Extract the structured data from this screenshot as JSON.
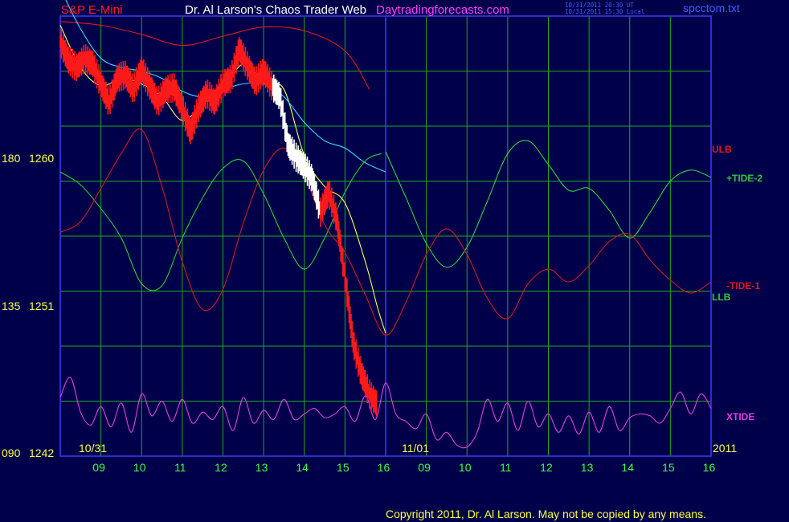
{
  "header": {
    "symbol": "S&P E-Mini",
    "title": "Dr. Al Larson's Chaos Trader Web",
    "site": "Daytradingforecasts.com",
    "timestamp_ut": "10/31/2011 20:30 UT",
    "timestamp_local": "10/31/2011 15:30 Local",
    "filename": "spcctom.txt"
  },
  "footer": {
    "copyright": "Copyright 2011, Dr. Al Larson. May not be copied by any means."
  },
  "colors": {
    "background": "#00004a",
    "grid": "#1fa81f",
    "frame": "#3a3aff",
    "price": "#ff1a1a",
    "price_recent": "#ffffff",
    "ulb": "#e01a1a",
    "llb": "#2ecc2e",
    "tide": "#3ad23a",
    "tide_neg": "#d21a1a",
    "xtide": "#e040e0",
    "ma_fast": "#ffff50",
    "ma_slow": "#40d8ff"
  },
  "chart_data": {
    "type": "line",
    "title": "S&P E-Mini",
    "y_axis": {
      "range": [
        1242,
        1266
      ],
      "ticks": [
        {
          "angle_label": "180",
          "price_label": "1260",
          "value": 1260
        },
        {
          "angle_label": "135",
          "price_label": "1251",
          "value": 1251
        },
        {
          "angle_label": "090",
          "price_label": "1242",
          "value": 1242
        }
      ]
    },
    "x_axis": {
      "hour_ticks": [
        "09",
        "10",
        "11",
        "12",
        "13",
        "14",
        "15",
        "16",
        "09",
        "10",
        "11",
        "12",
        "13",
        "14",
        "15",
        "16"
      ],
      "date_labels": [
        "10/31",
        "11/01"
      ],
      "year_label": "2011"
    },
    "series_labels": [
      "ULB",
      "+TIDE-2",
      "-TIDE-1",
      "LLB",
      "XTIDE"
    ],
    "series": [
      {
        "name": "ULB",
        "x": [
          0,
          1,
          2,
          3,
          4,
          5,
          6,
          7,
          7.6
        ],
        "y": [
          1265.7,
          1265.5,
          1265.0,
          1264.4,
          1264.9,
          1265.4,
          1265.2,
          1264.1,
          1262.0
        ]
      },
      {
        "name": "LLB",
        "x": [
          0,
          0.5,
          1,
          1.5,
          2,
          2.5,
          3,
          3.5,
          4,
          4.5,
          5,
          5.5,
          6,
          6.5,
          7,
          7.5,
          7.9
        ],
        "y": [
          1257.5,
          1256.8,
          1255.5,
          1253.9,
          1251.4,
          1251.3,
          1253.9,
          1256.1,
          1257.7,
          1258.1,
          1256.3,
          1253.9,
          1252.2,
          1253.9,
          1256.4,
          1258.1,
          1258.5
        ]
      },
      {
        "name": "+TIDE-2",
        "x": [
          8.0,
          8.5,
          9.0,
          9.5,
          10.0,
          10.5,
          11.0,
          11.5,
          12.0,
          12.5,
          13.0,
          13.5,
          14.0,
          14.5,
          15.0,
          15.5,
          16.0
        ],
        "y": [
          1258.6,
          1256.1,
          1253.6,
          1252.3,
          1253.4,
          1255.9,
          1258.5,
          1259.2,
          1257.9,
          1256.5,
          1256.6,
          1255.4,
          1253.9,
          1255.3,
          1257.0,
          1257.6,
          1257.2
        ]
      },
      {
        "name": "-TIDE-1",
        "x": [
          0,
          0.5,
          1,
          1.5,
          2,
          2.5,
          3,
          3.5,
          4,
          4.5,
          5,
          5.5,
          6,
          6.5,
          7,
          7.5,
          8,
          8.5,
          9,
          9.5,
          10,
          10.5,
          11,
          11.5,
          12,
          12.5,
          13,
          13.5,
          14,
          14.5,
          15,
          15.5,
          16
        ],
        "y": [
          1254.2,
          1254.8,
          1256.6,
          1258.5,
          1259.8,
          1256.7,
          1252.6,
          1250.0,
          1251.1,
          1254.7,
          1257.6,
          1258.8,
          1257.3,
          1254.6,
          1253.1,
          1250.8,
          1248.6,
          1250.4,
          1253.0,
          1254.4,
          1253.0,
          1250.6,
          1249.5,
          1251.4,
          1252.2,
          1251.5,
          1252.4,
          1253.7,
          1254.1,
          1252.7,
          1251.6,
          1250.9,
          1251.5
        ]
      },
      {
        "name": "XTIDE",
        "x": [
          0,
          0.25,
          0.5,
          0.75,
          1,
          1.25,
          1.5,
          1.75,
          2,
          2.25,
          2.5,
          2.75,
          3,
          3.25,
          3.5,
          3.75,
          4,
          4.25,
          4.5,
          4.75,
          5,
          5.25,
          5.5,
          5.75,
          6,
          6.25,
          6.5,
          6.75,
          7,
          7.25,
          7.5,
          7.75,
          8,
          8.25,
          8.5,
          8.75,
          9,
          9.25,
          9.5,
          9.75,
          10,
          10.25,
          10.5,
          10.75,
          11,
          11.25,
          11.5,
          11.75,
          12,
          12.25,
          12.5,
          12.75,
          13,
          13.25,
          13.5,
          13.75,
          14,
          14.25,
          14.5,
          14.75,
          15,
          15.25,
          15.5,
          15.75,
          16
        ],
        "y": [
          1245.2,
          1246.3,
          1244.4,
          1243.7,
          1244.7,
          1243.6,
          1244.9,
          1243.3,
          1245.4,
          1244.2,
          1245.0,
          1243.9,
          1245.1,
          1243.8,
          1244.4,
          1244.0,
          1244.7,
          1243.4,
          1245.2,
          1243.8,
          1244.5,
          1244.0,
          1245.1,
          1244.0,
          1244.3,
          1244.6,
          1244.1,
          1244.3,
          1244.7,
          1243.9,
          1245.3,
          1244.0,
          1246.0,
          1244.3,
          1243.9,
          1243.5,
          1244.3,
          1242.9,
          1243.3,
          1242.6,
          1242.5,
          1243.3,
          1245.1,
          1243.9,
          1244.9,
          1243.4,
          1245.0,
          1243.6,
          1244.3,
          1243.3,
          1244.2,
          1243.2,
          1244.4,
          1243.3,
          1244.7,
          1243.4,
          1244.1,
          1244.3,
          1244.2,
          1243.8,
          1244.6,
          1245.5,
          1244.3,
          1245.4,
          1244.6
        ]
      },
      {
        "name": "S&P E-Mini",
        "x": [
          0,
          0.2,
          0.4,
          0.6,
          0.8,
          1.0,
          1.2,
          1.4,
          1.6,
          1.8,
          2.0,
          2.2,
          2.4,
          2.6,
          2.8,
          3.0,
          3.2,
          3.4,
          3.6,
          3.8,
          4.0,
          4.2,
          4.4,
          4.6,
          4.8,
          5.0,
          5.2,
          5.4,
          5.6,
          5.8,
          6.0,
          6.2,
          6.4,
          6.6,
          6.8,
          7.0,
          7.2,
          7.4,
          7.6,
          7.8
        ],
        "y": [
          1264.6,
          1263.6,
          1263.2,
          1263.7,
          1263.4,
          1262.3,
          1261.3,
          1262.6,
          1262.8,
          1262.0,
          1263.1,
          1262.2,
          1261.3,
          1262.0,
          1262.1,
          1261.0,
          1259.7,
          1261.0,
          1261.8,
          1261.3,
          1262.3,
          1262.6,
          1264.2,
          1263.3,
          1262.4,
          1263.0,
          1262.2,
          1261.6,
          1259.0,
          1258.3,
          1257.8,
          1257.1,
          1255.3,
          1256.4,
          1254.9,
          1251.8,
          1248.2,
          1246.5,
          1245.4,
          1244.8
        ]
      },
      {
        "name": "fast-average",
        "x": [
          0,
          0.5,
          1,
          1.5,
          2,
          2.5,
          3,
          3.5,
          4,
          4.5,
          5,
          5.5,
          6,
          6.5,
          7,
          7.5,
          7.8,
          8.0
        ],
        "y": [
          1265.5,
          1263.2,
          1262.2,
          1262.6,
          1262.3,
          1261.6,
          1260.3,
          1261.2,
          1262.0,
          1263.4,
          1262.4,
          1262.0,
          1258.4,
          1256.7,
          1255.8,
          1252.6,
          1250.1,
          1248.7
        ]
      },
      {
        "name": "slow-average",
        "x": [
          0,
          0.5,
          1,
          1.5,
          2,
          2.5,
          3,
          3.5,
          4,
          4.5,
          5,
          5.5,
          6,
          6.5,
          7,
          7.5,
          8.0
        ],
        "y": [
          1267.5,
          1265.3,
          1263.7,
          1263.2,
          1263.0,
          1262.6,
          1261.9,
          1261.6,
          1262.0,
          1262.3,
          1262.3,
          1261.6,
          1260.2,
          1259.2,
          1258.8,
          1258.0,
          1257.5
        ]
      }
    ]
  }
}
